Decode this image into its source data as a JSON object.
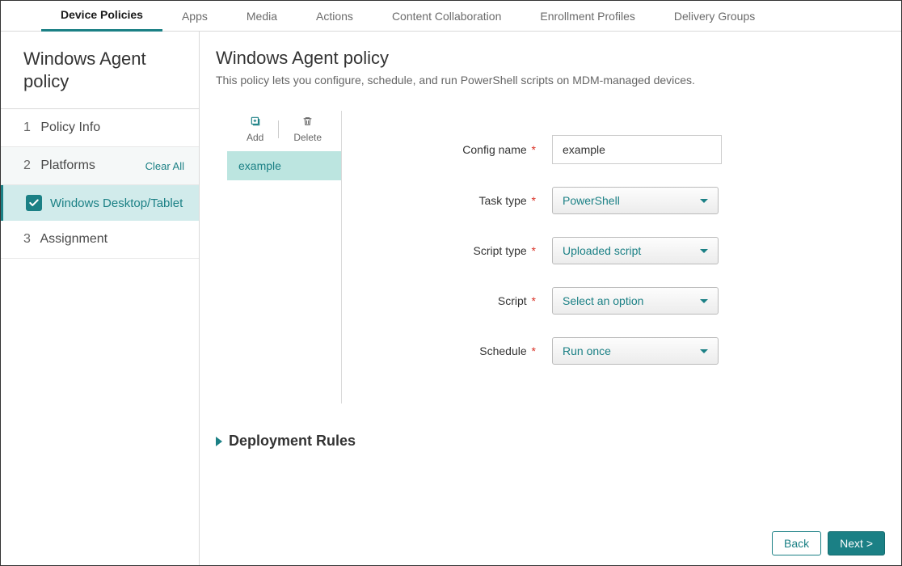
{
  "topTabs": {
    "devicePolicies": "Device Policies",
    "apps": "Apps",
    "media": "Media",
    "actions": "Actions",
    "contentCollab": "Content Collaboration",
    "enrollment": "Enrollment Profiles",
    "deliveryGroups": "Delivery Groups"
  },
  "sidebar": {
    "title": "Windows Agent policy",
    "step1": {
      "num": "1",
      "label": "Policy Info"
    },
    "step2": {
      "num": "2",
      "label": "Platforms",
      "clearAll": "Clear All"
    },
    "platform": {
      "label": "Windows Desktop/Tablet"
    },
    "step3": {
      "num": "3",
      "label": "Assignment"
    }
  },
  "page": {
    "title": "Windows Agent policy",
    "description": "This policy lets you configure, schedule, and run PowerShell scripts on MDM-managed devices."
  },
  "toolbar": {
    "add": "Add",
    "delete": "Delete"
  },
  "configList": {
    "item0": "example"
  },
  "form": {
    "configName": {
      "label": "Config name",
      "value": "example"
    },
    "taskType": {
      "label": "Task type",
      "value": "PowerShell"
    },
    "scriptType": {
      "label": "Script type",
      "value": "Uploaded script"
    },
    "script": {
      "label": "Script",
      "value": "Select an option"
    },
    "schedule": {
      "label": "Schedule",
      "value": "Run once"
    }
  },
  "deployment": {
    "title": "Deployment Rules"
  },
  "footer": {
    "back": "Back",
    "next": "Next >"
  }
}
